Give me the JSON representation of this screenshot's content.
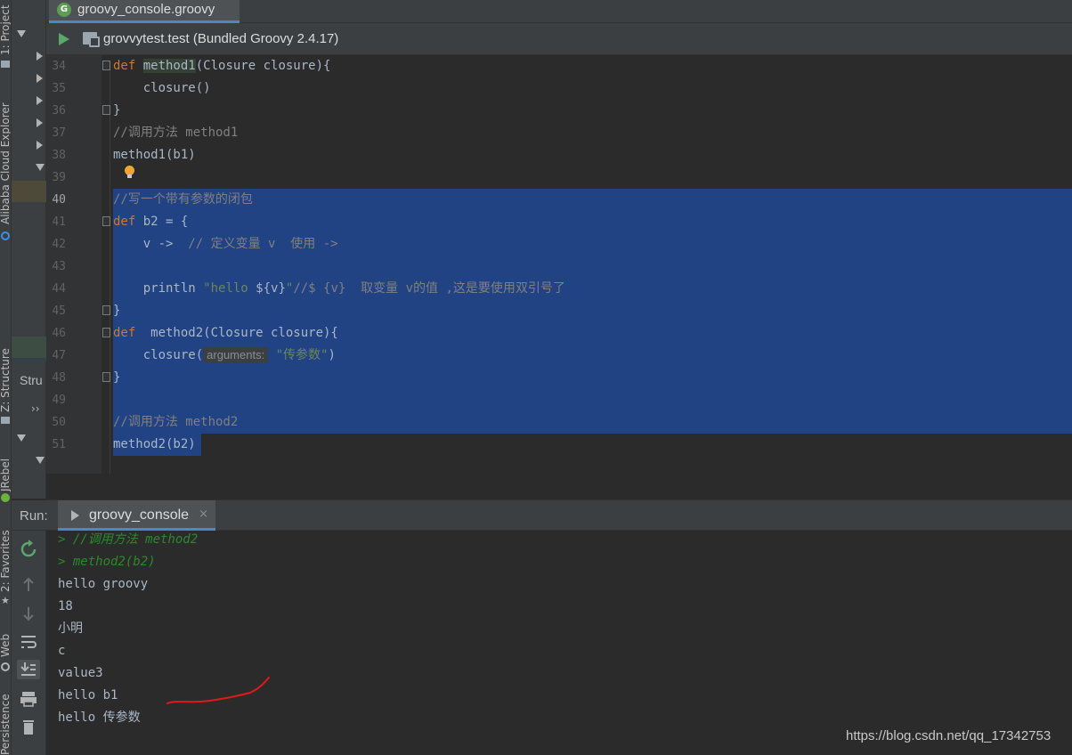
{
  "window": {
    "active_tab": "groovy_console.groovy",
    "tab_icon_letter": "G",
    "run_config": "grovvytest.test (Bundled Groovy 2.4.17)"
  },
  "side_strip": {
    "project": "1: Project",
    "cloud": "Alibaba Cloud Explorer",
    "structure": "Z: Structure",
    "jrebel": "JRebel",
    "favorites": "2: Favorites",
    "web": "Web",
    "persistence": "Persistence"
  },
  "structure_panel": {
    "label": "Stru",
    "expand": "››"
  },
  "editor": {
    "current_line": "40",
    "lines": [
      {
        "num": "34",
        "tokens": [
          {
            "t": "def ",
            "c": "kw"
          },
          {
            "t": "method1",
            "c": "hlname"
          },
          {
            "t": "(Closure closure){",
            "c": ""
          }
        ]
      },
      {
        "num": "35",
        "tokens": [
          {
            "t": "    closure()",
            "c": ""
          }
        ]
      },
      {
        "num": "36",
        "tokens": [
          {
            "t": "}",
            "c": ""
          }
        ]
      },
      {
        "num": "37",
        "tokens": [
          {
            "t": "//调用方法 method1",
            "c": "cm"
          }
        ]
      },
      {
        "num": "38",
        "tokens": [
          {
            "t": "method1(b1)",
            "c": ""
          }
        ]
      },
      {
        "num": "39",
        "tokens": []
      },
      {
        "num": "40",
        "tokens": [
          {
            "t": "//写一个带有参数的闭包",
            "c": "cm"
          }
        ]
      },
      {
        "num": "41",
        "tokens": [
          {
            "t": "def ",
            "c": "kw"
          },
          {
            "t": "b2 = {",
            "c": ""
          }
        ]
      },
      {
        "num": "42",
        "tokens": [
          {
            "t": "    v -> ",
            "c": ""
          },
          {
            "t": " // 定义变量 v  使用 ->",
            "c": "cm"
          }
        ]
      },
      {
        "num": "43",
        "tokens": []
      },
      {
        "num": "44",
        "tokens": [
          {
            "t": "    println ",
            "c": ""
          },
          {
            "t": "\"hello ",
            "c": "str"
          },
          {
            "t": "${v}",
            "c": ""
          },
          {
            "t": "\"",
            "c": "str"
          },
          {
            "t": "//$ {v}  取变量 v的值 ,这是要使用双引号了",
            "c": "cm"
          }
        ]
      },
      {
        "num": "45",
        "tokens": [
          {
            "t": "}",
            "c": ""
          }
        ]
      },
      {
        "num": "46",
        "tokens": [
          {
            "t": "def ",
            "c": "kw"
          },
          {
            "t": " method2(Closure closure){",
            "c": ""
          }
        ]
      },
      {
        "num": "47",
        "tokens": [
          {
            "t": "    closure(",
            "c": ""
          },
          {
            "t": "arguments:",
            "c": "hint"
          },
          {
            "t": " \"传参数\"",
            "c": "str"
          },
          {
            "t": ")",
            "c": ""
          }
        ]
      },
      {
        "num": "48",
        "tokens": [
          {
            "t": "}",
            "c": ""
          }
        ]
      },
      {
        "num": "49",
        "tokens": []
      },
      {
        "num": "50",
        "tokens": [
          {
            "t": "//调用方法 method2",
            "c": "cm"
          }
        ]
      },
      {
        "num": "51",
        "tokens": [
          {
            "t": "method2(b2)",
            "c": ""
          }
        ]
      }
    ]
  },
  "run_panel": {
    "label": "Run:",
    "tab": "groovy_console",
    "close": "×",
    "output": [
      {
        "text": "> //调用方法 method2",
        "kind": "echo"
      },
      {
        "text": "> method2(b2)",
        "kind": "echo"
      },
      {
        "text": "hello groovy",
        "kind": "out"
      },
      {
        "text": "18",
        "kind": "out"
      },
      {
        "text": "小明",
        "kind": "out"
      },
      {
        "text": "c",
        "kind": "out"
      },
      {
        "text": "value3",
        "kind": "out"
      },
      {
        "text": "hello b1",
        "kind": "out"
      },
      {
        "text": "hello 传参数",
        "kind": "out"
      }
    ]
  },
  "watermark": "https://blog.csdn.net/qq_17342753",
  "colors": {
    "selection": "#214283",
    "keyword": "#cc7832",
    "comment": "#808080",
    "string": "#6a8759",
    "echo": "#2a8a2a",
    "annotation_stroke": "#e01a1a"
  }
}
